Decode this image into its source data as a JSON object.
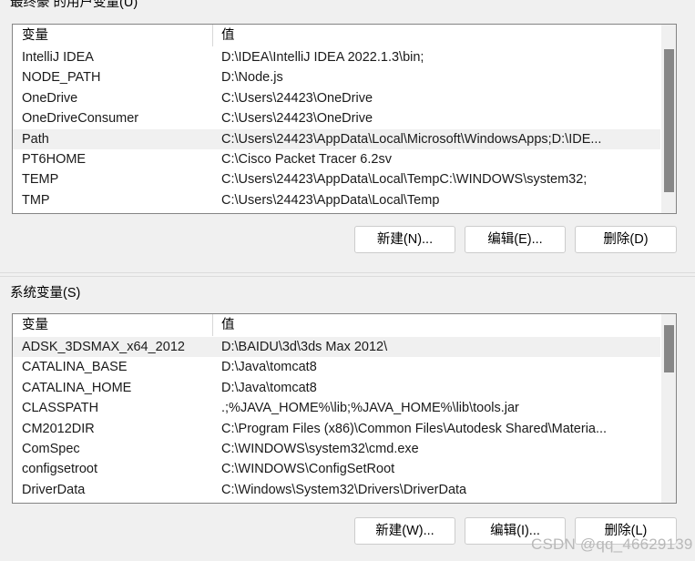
{
  "window": {
    "user_section_label": "最终豪 的用户变量(U)",
    "system_section_label": "系统变量(S)"
  },
  "columns": {
    "name": "变量",
    "value": "值"
  },
  "user_variables": {
    "scroll_thumb": {
      "top_pct": 13,
      "height_pct": 76
    },
    "rows": [
      {
        "name": "IntelliJ IDEA",
        "value": "D:\\IDEA\\IntelliJ IDEA 2022.1.3\\bin;",
        "selected": false
      },
      {
        "name": "NODE_PATH",
        "value": "D:\\Node.js",
        "selected": false
      },
      {
        "name": "OneDrive",
        "value": "C:\\Users\\24423\\OneDrive",
        "selected": false
      },
      {
        "name": "OneDriveConsumer",
        "value": "C:\\Users\\24423\\OneDrive",
        "selected": false
      },
      {
        "name": "Path",
        "value": "C:\\Users\\24423\\AppData\\Local\\Microsoft\\WindowsApps;D:\\IDE...",
        "selected": true
      },
      {
        "name": "PT6HOME",
        "value": "C:\\Cisco Packet Tracer 6.2sv",
        "selected": false
      },
      {
        "name": "TEMP",
        "value": "C:\\Users\\24423\\AppData\\Local\\TempC:\\WINDOWS\\system32;",
        "selected": false
      },
      {
        "name": "TMP",
        "value": "C:\\Users\\24423\\AppData\\Local\\Temp",
        "selected": false
      }
    ]
  },
  "system_variables": {
    "scroll_thumb": {
      "top_pct": 6,
      "height_pct": 25
    },
    "rows": [
      {
        "name": "ADSK_3DSMAX_x64_2012",
        "value": "D:\\BAIDU\\3d\\3ds Max 2012\\",
        "selected": true
      },
      {
        "name": "CATALINA_BASE",
        "value": "D:\\Java\\tomcat8",
        "selected": false
      },
      {
        "name": "CATALINA_HOME",
        "value": "D:\\Java\\tomcat8",
        "selected": false
      },
      {
        "name": "CLASSPATH",
        "value": ".;%JAVA_HOME%\\lib;%JAVA_HOME%\\lib\\tools.jar",
        "selected": false
      },
      {
        "name": "CM2012DIR",
        "value": "C:\\Program Files (x86)\\Common Files\\Autodesk Shared\\Materia...",
        "selected": false
      },
      {
        "name": "ComSpec",
        "value": "C:\\WINDOWS\\system32\\cmd.exe",
        "selected": false
      },
      {
        "name": "configsetroot",
        "value": "C:\\WINDOWS\\ConfigSetRoot",
        "selected": false
      },
      {
        "name": "DriverData",
        "value": "C:\\Windows\\System32\\Drivers\\DriverData",
        "selected": false
      }
    ]
  },
  "user_buttons": {
    "new": "新建(N)...",
    "edit": "编辑(E)...",
    "delete": "删除(D)"
  },
  "system_buttons": {
    "new": "新建(W)...",
    "edit": "编辑(I)...",
    "delete": "删除(L)"
  },
  "watermark": "CSDN @qq_46629139",
  "colors": {
    "dialog_bg": "#f0f0f0",
    "list_bg": "#ffffff",
    "list_border": "#848484",
    "row_selected": "#f0f0f0",
    "scroll_thumb": "#878787",
    "button_border": "#cccccc",
    "watermark": "#b9b9b9"
  }
}
